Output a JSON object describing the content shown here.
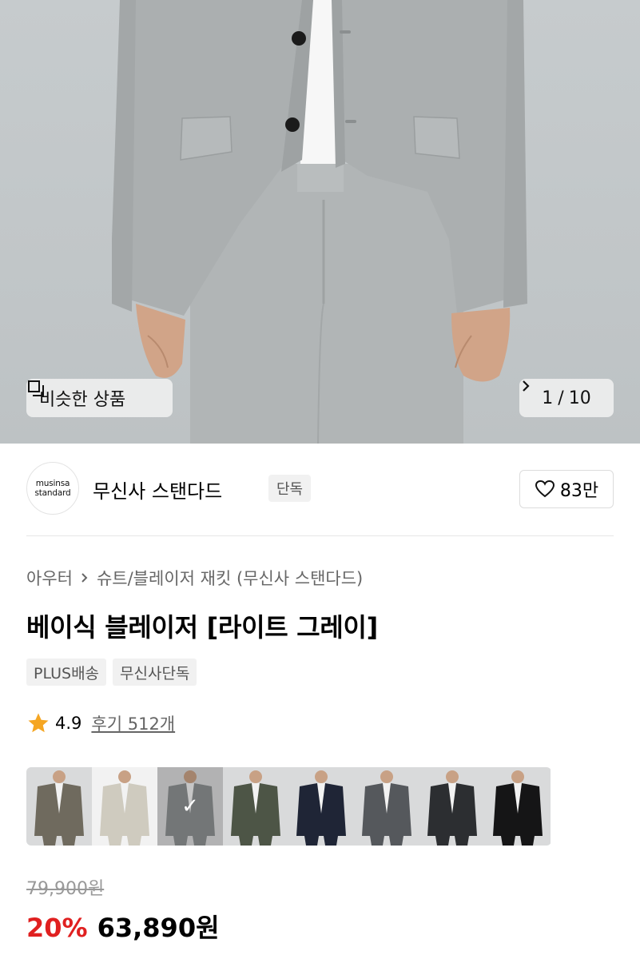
{
  "hero": {
    "similar_label": "비슷한 상품",
    "pager_current": "1",
    "pager_sep": "/",
    "pager_total": "10"
  },
  "brand": {
    "logo_line1": "musinsa",
    "logo_line2": "standard",
    "name": "무신사 스탠다드",
    "badge": "단독",
    "likes": "83만"
  },
  "product": {
    "breadcrumb": [
      "아우터",
      "슈트/블레이저 재킷 (무신사 스탠다드)"
    ],
    "title": "베이식 블레이저 [라이트 그레이]",
    "tags": [
      "PLUS배송",
      "무신사단독"
    ],
    "rating": "4.9",
    "reviews": "후기 512개"
  },
  "color_options": [
    {
      "color": "#6f6a5e",
      "selected": false
    },
    {
      "color": "#cfcbbf",
      "selected": false
    },
    {
      "color": "#8d9192",
      "selected": true
    },
    {
      "color": "#4d5546",
      "selected": false
    },
    {
      "color": "#1f2536",
      "selected": false
    },
    {
      "color": "#55585c",
      "selected": false
    },
    {
      "color": "#2c2e31",
      "selected": false
    },
    {
      "color": "#151516",
      "selected": false
    }
  ],
  "price": {
    "original": "79,900원",
    "discount": "20%",
    "sale": "63,890원"
  },
  "colors": {
    "discount": "#e02020",
    "star": "#f5a623",
    "suit": "#aeb2b3"
  }
}
